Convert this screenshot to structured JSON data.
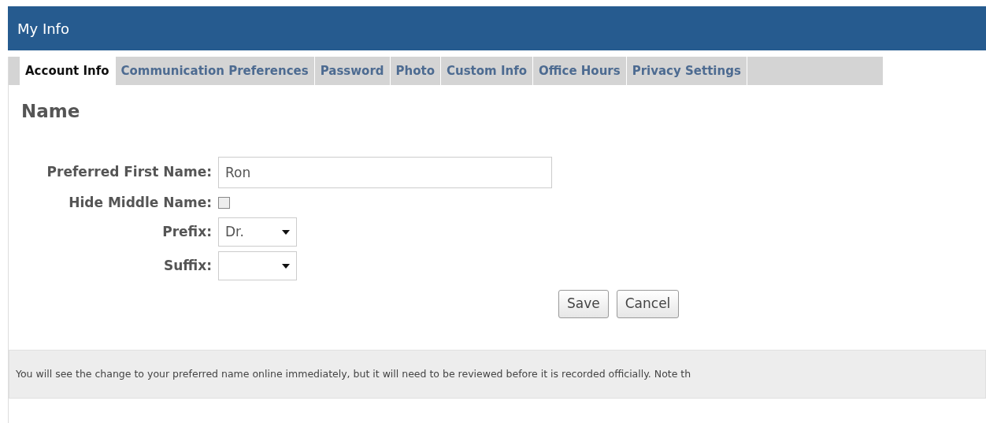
{
  "header": {
    "title": "My Info"
  },
  "tabs": [
    {
      "label": "Account Info",
      "selected": true
    },
    {
      "label": "Communication Preferences",
      "selected": false
    },
    {
      "label": "Password",
      "selected": false
    },
    {
      "label": "Photo",
      "selected": false
    },
    {
      "label": "Custom Info",
      "selected": false
    },
    {
      "label": "Office Hours",
      "selected": false
    },
    {
      "label": "Privacy Settings",
      "selected": false
    }
  ],
  "section_title": "Name",
  "fields": [
    {
      "kind": "text",
      "label": "Preferred First Name:",
      "value": "Ron"
    },
    {
      "kind": "checkbox",
      "label": "Hide Middle Name:",
      "checked": false
    },
    {
      "kind": "select",
      "label": "Prefix:",
      "value": "Dr."
    },
    {
      "kind": "select",
      "label": "Suffix:"
    }
  ],
  "buttons": [
    "Save",
    "Cancel"
  ],
  "note": "You will see the change to your preferred name online immediately, but it will need to be reviewed before it is recorded officially. Note th"
}
